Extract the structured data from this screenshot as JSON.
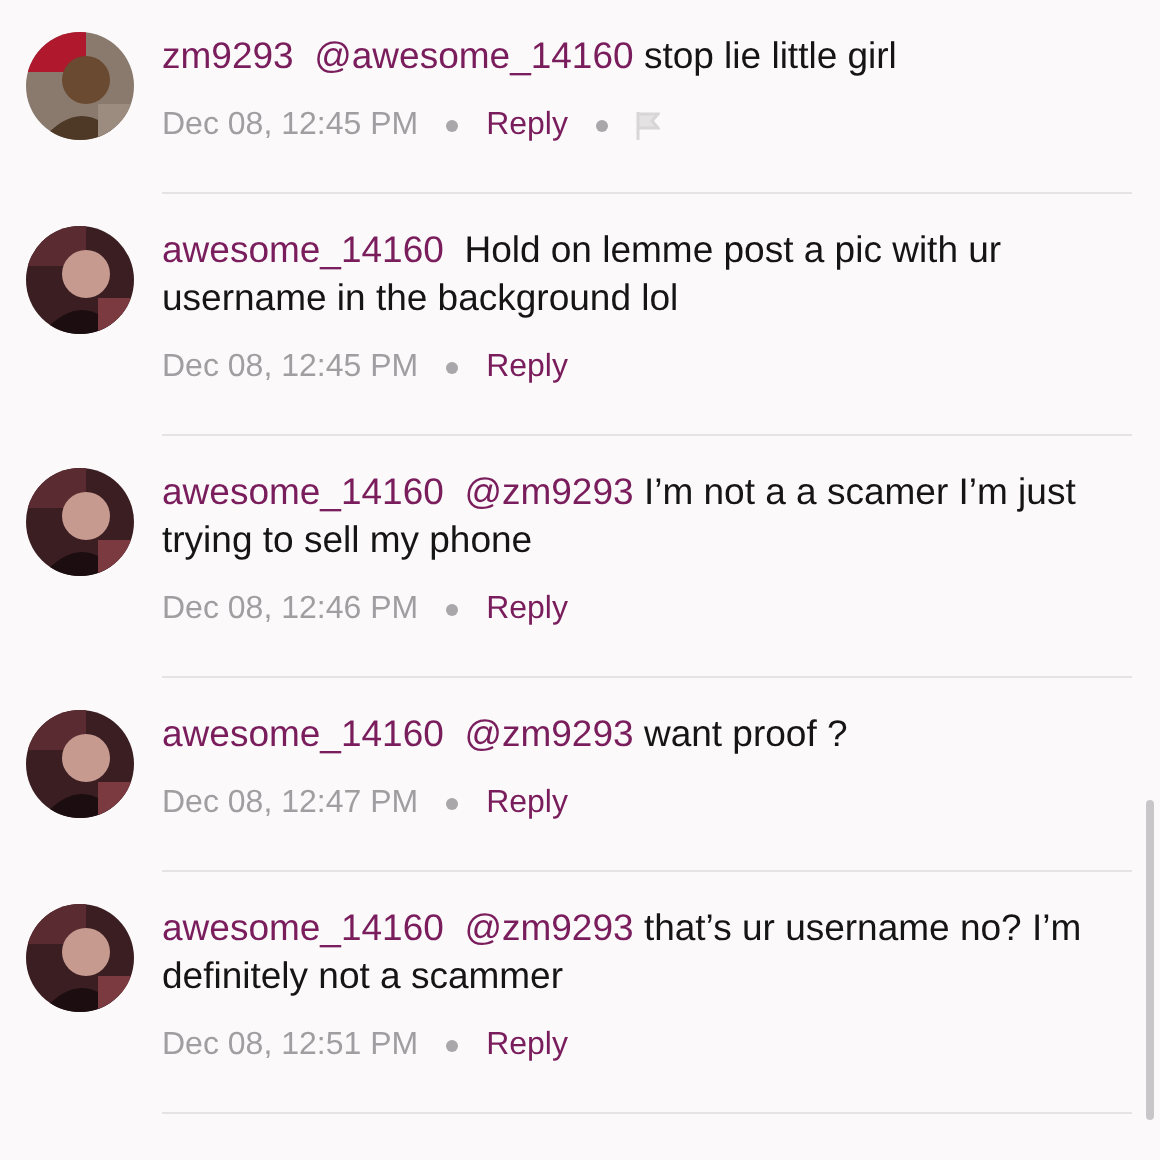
{
  "comments": [
    {
      "username": "zm9293",
      "mention": "@awesome_14160",
      "text": "stop lie little girl",
      "time": "Dec 08, 12:45 PM",
      "reply": "Reply",
      "flag": true
    },
    {
      "username": "awesome_14160",
      "text": "Hold on lemme post a pic with ur username in the background lol",
      "time": "Dec 08, 12:45 PM",
      "reply": "Reply",
      "flag": false
    },
    {
      "username": "awesome_14160",
      "mention": "@zm9293",
      "text": "I’m not a a scamer I’m just trying to sell my phone",
      "time": "Dec 08, 12:46 PM",
      "reply": "Reply",
      "flag": false
    },
    {
      "username": "awesome_14160",
      "mention": "@zm9293",
      "text": "want proof ?",
      "time": "Dec 08, 12:47 PM",
      "reply": "Reply",
      "flag": false
    },
    {
      "username": "awesome_14160",
      "mention": "@zm9293",
      "text": "that’s ur username no? I’m definitely not a scammer",
      "time": "Dec 08, 12:51 PM",
      "reply": "Reply",
      "flag": false
    }
  ]
}
